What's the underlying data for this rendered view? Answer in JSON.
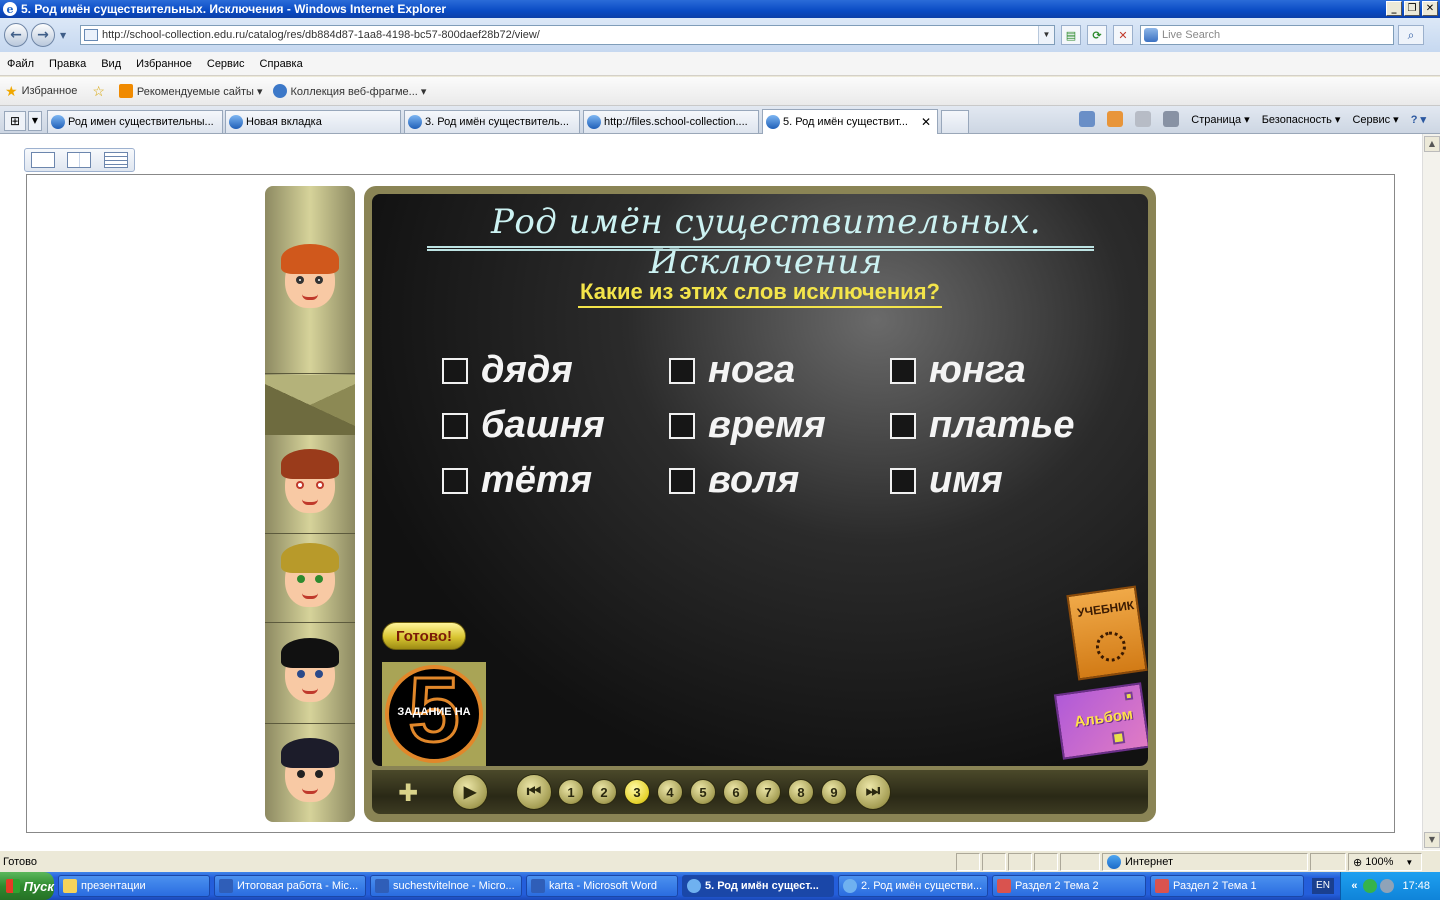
{
  "window": {
    "title": "5. Род имён существительных. Исключения - Windows Internet Explorer",
    "min_label": "_",
    "max_label": "❐",
    "close_label": "✕"
  },
  "address_bar": {
    "url": "http://school-collection.edu.ru/catalog/res/db884d87-1aa8-4198-bc57-800daef28b72/view/"
  },
  "search": {
    "placeholder": "Live Search"
  },
  "menu": [
    "Файл",
    "Правка",
    "Вид",
    "Избранное",
    "Сервис",
    "Справка"
  ],
  "favorites_bar": {
    "favorites_label": "Избранное",
    "recommended_label": "Рекомендуемые сайты ▾",
    "webslice_label": "Коллекция веб-фрагме... ▾"
  },
  "tabs": [
    {
      "label": "Род имен существительны...",
      "active": false
    },
    {
      "label": "Новая вкладка",
      "active": false
    },
    {
      "label": "3. Род имён существитель...",
      "active": false
    },
    {
      "label": "http://files.school-collection....",
      "active": false
    },
    {
      "label": "5. Род имён существит...",
      "active": true
    }
  ],
  "command_bar": {
    "page_label": "Страница ▾",
    "safety_label": "Безопасность ▾",
    "tools_label": "Сервис ▾",
    "help_label": "? ▾"
  },
  "lesson": {
    "title": "Род имён существительных. Исключения",
    "question": "Какие из этих слов исключения?",
    "words": [
      [
        "дядя",
        "нога",
        "юнга"
      ],
      [
        "башня",
        "время",
        "платье"
      ],
      [
        "тётя",
        "воля",
        "имя"
      ]
    ],
    "ready_label": "Готово!",
    "task_number": "5",
    "task_label": "ЗАДАНИЕ НА",
    "textbook_label": "УЧЕБНИК",
    "album_label": "Альбом",
    "pages": [
      "1",
      "2",
      "3",
      "4",
      "5",
      "6",
      "7",
      "8",
      "9"
    ],
    "current_page": "3"
  },
  "status_bar": {
    "status": "Готово",
    "zone": "Интернет",
    "zoom": "100%"
  },
  "taskbar": {
    "start_label": "Пуск",
    "items": [
      {
        "label": "презентации",
        "active": false
      },
      {
        "label": "Итоговая работа - Mic...",
        "active": false
      },
      {
        "label": "suchestvitelnoe - Micro...",
        "active": false
      },
      {
        "label": "karta - Microsoft Word",
        "active": false
      },
      {
        "label": "5. Род имён сущест...",
        "active": true
      },
      {
        "label": "2. Род имён существи...",
        "active": false
      },
      {
        "label": "Раздел 2 Тема 2",
        "active": false
      },
      {
        "label": "Раздел 2 Тема 1",
        "active": false
      }
    ],
    "lang": "EN",
    "clock": "17:48"
  },
  "colors": {
    "title_text": "#ccf2f2",
    "question_text": "#f3e44a",
    "word_text": "#f4f4f4",
    "board_frame": "#8a8455"
  }
}
